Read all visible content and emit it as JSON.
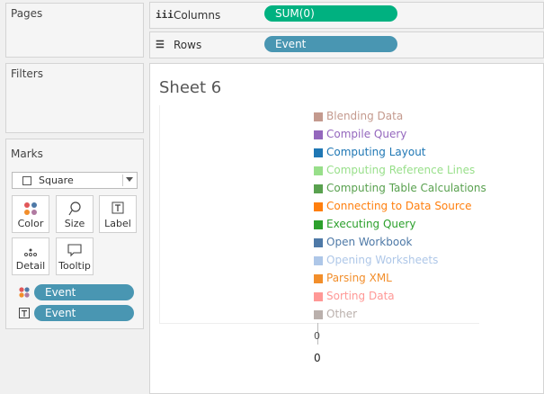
{
  "left": {
    "pages_title": "Pages",
    "filters_title": "Filters",
    "marks_title": "Marks",
    "mark_type": "Square",
    "buttons": [
      {
        "label": "Color",
        "icon": "color-dots-icon"
      },
      {
        "label": "Size",
        "icon": "size-lasso-icon"
      },
      {
        "label": "Label",
        "icon": "label-t-icon"
      },
      {
        "label": "Detail",
        "icon": "detail-dots-icon"
      },
      {
        "label": "Tooltip",
        "icon": "tooltip-bubble-icon"
      }
    ],
    "mark_fields": [
      {
        "label": "Event",
        "icon": "color-dots-icon"
      },
      {
        "label": "Event",
        "icon": "label-t-icon"
      }
    ]
  },
  "columns": {
    "label": "Columns",
    "pill": "SUM(0)",
    "icon": "columns-icon"
  },
  "rows": {
    "label": "Rows",
    "pill": "Event",
    "icon": "rows-icon"
  },
  "sheet_title": "Sheet 6",
  "axis_value": "0",
  "axis_value_2": "0",
  "colors": {
    "columns_pill": "#00b180",
    "rows_pill": "#4996b2"
  },
  "chart_data": {
    "type": "bar",
    "categories": [
      "Blending Data",
      "Compile Query",
      "Computing Layout",
      "Computing Reference Lines",
      "Computing Table Calculations",
      "Connecting to Data Source",
      "Executing Query",
      "Open Workbook",
      "Opening Worksheets",
      "Parsing XML",
      "Sorting Data",
      "Other"
    ],
    "colors": [
      "#c49a8e",
      "#9467bd",
      "#1f77b4",
      "#98df8a",
      "#59a14f",
      "#ff7f0e",
      "#2ca02c",
      "#4e79a7",
      "#aec7e8",
      "#f28e2b",
      "#ff9896",
      "#bab0ac"
    ],
    "values": [
      0,
      0,
      0,
      0,
      0,
      0,
      0,
      0,
      0,
      0,
      0,
      0
    ],
    "xlabel": "",
    "ylabel": ""
  }
}
